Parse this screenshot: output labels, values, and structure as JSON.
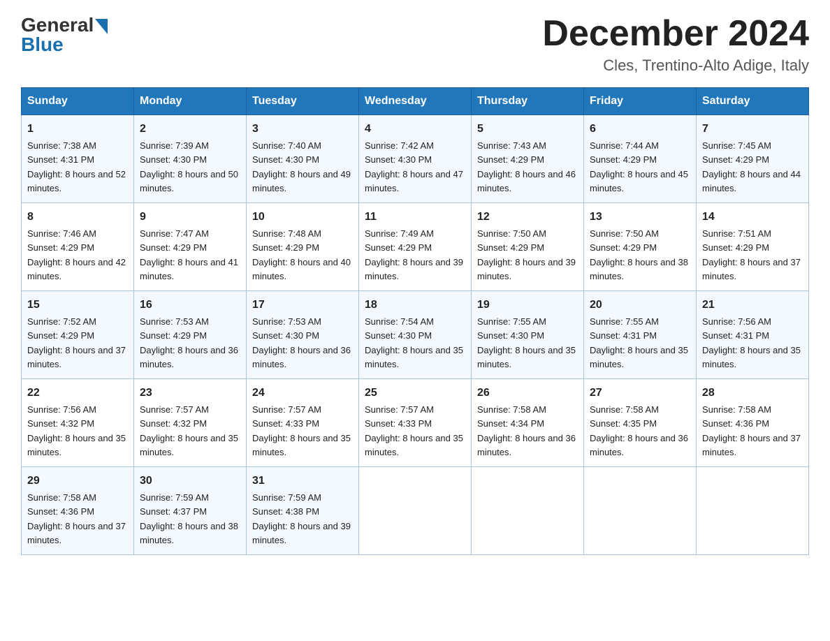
{
  "header": {
    "logo_general": "General",
    "logo_blue": "Blue",
    "month_title": "December 2024",
    "location": "Cles, Trentino-Alto Adige, Italy"
  },
  "days_of_week": [
    "Sunday",
    "Monday",
    "Tuesday",
    "Wednesday",
    "Thursday",
    "Friday",
    "Saturday"
  ],
  "weeks": [
    [
      {
        "day": "1",
        "sunrise": "7:38 AM",
        "sunset": "4:31 PM",
        "daylight": "8 hours and 52 minutes."
      },
      {
        "day": "2",
        "sunrise": "7:39 AM",
        "sunset": "4:30 PM",
        "daylight": "8 hours and 50 minutes."
      },
      {
        "day": "3",
        "sunrise": "7:40 AM",
        "sunset": "4:30 PM",
        "daylight": "8 hours and 49 minutes."
      },
      {
        "day": "4",
        "sunrise": "7:42 AM",
        "sunset": "4:30 PM",
        "daylight": "8 hours and 47 minutes."
      },
      {
        "day": "5",
        "sunrise": "7:43 AM",
        "sunset": "4:29 PM",
        "daylight": "8 hours and 46 minutes."
      },
      {
        "day": "6",
        "sunrise": "7:44 AM",
        "sunset": "4:29 PM",
        "daylight": "8 hours and 45 minutes."
      },
      {
        "day": "7",
        "sunrise": "7:45 AM",
        "sunset": "4:29 PM",
        "daylight": "8 hours and 44 minutes."
      }
    ],
    [
      {
        "day": "8",
        "sunrise": "7:46 AM",
        "sunset": "4:29 PM",
        "daylight": "8 hours and 42 minutes."
      },
      {
        "day": "9",
        "sunrise": "7:47 AM",
        "sunset": "4:29 PM",
        "daylight": "8 hours and 41 minutes."
      },
      {
        "day": "10",
        "sunrise": "7:48 AM",
        "sunset": "4:29 PM",
        "daylight": "8 hours and 40 minutes."
      },
      {
        "day": "11",
        "sunrise": "7:49 AM",
        "sunset": "4:29 PM",
        "daylight": "8 hours and 39 minutes."
      },
      {
        "day": "12",
        "sunrise": "7:50 AM",
        "sunset": "4:29 PM",
        "daylight": "8 hours and 39 minutes."
      },
      {
        "day": "13",
        "sunrise": "7:50 AM",
        "sunset": "4:29 PM",
        "daylight": "8 hours and 38 minutes."
      },
      {
        "day": "14",
        "sunrise": "7:51 AM",
        "sunset": "4:29 PM",
        "daylight": "8 hours and 37 minutes."
      }
    ],
    [
      {
        "day": "15",
        "sunrise": "7:52 AM",
        "sunset": "4:29 PM",
        "daylight": "8 hours and 37 minutes."
      },
      {
        "day": "16",
        "sunrise": "7:53 AM",
        "sunset": "4:29 PM",
        "daylight": "8 hours and 36 minutes."
      },
      {
        "day": "17",
        "sunrise": "7:53 AM",
        "sunset": "4:30 PM",
        "daylight": "8 hours and 36 minutes."
      },
      {
        "day": "18",
        "sunrise": "7:54 AM",
        "sunset": "4:30 PM",
        "daylight": "8 hours and 35 minutes."
      },
      {
        "day": "19",
        "sunrise": "7:55 AM",
        "sunset": "4:30 PM",
        "daylight": "8 hours and 35 minutes."
      },
      {
        "day": "20",
        "sunrise": "7:55 AM",
        "sunset": "4:31 PM",
        "daylight": "8 hours and 35 minutes."
      },
      {
        "day": "21",
        "sunrise": "7:56 AM",
        "sunset": "4:31 PM",
        "daylight": "8 hours and 35 minutes."
      }
    ],
    [
      {
        "day": "22",
        "sunrise": "7:56 AM",
        "sunset": "4:32 PM",
        "daylight": "8 hours and 35 minutes."
      },
      {
        "day": "23",
        "sunrise": "7:57 AM",
        "sunset": "4:32 PM",
        "daylight": "8 hours and 35 minutes."
      },
      {
        "day": "24",
        "sunrise": "7:57 AM",
        "sunset": "4:33 PM",
        "daylight": "8 hours and 35 minutes."
      },
      {
        "day": "25",
        "sunrise": "7:57 AM",
        "sunset": "4:33 PM",
        "daylight": "8 hours and 35 minutes."
      },
      {
        "day": "26",
        "sunrise": "7:58 AM",
        "sunset": "4:34 PM",
        "daylight": "8 hours and 36 minutes."
      },
      {
        "day": "27",
        "sunrise": "7:58 AM",
        "sunset": "4:35 PM",
        "daylight": "8 hours and 36 minutes."
      },
      {
        "day": "28",
        "sunrise": "7:58 AM",
        "sunset": "4:36 PM",
        "daylight": "8 hours and 37 minutes."
      }
    ],
    [
      {
        "day": "29",
        "sunrise": "7:58 AM",
        "sunset": "4:36 PM",
        "daylight": "8 hours and 37 minutes."
      },
      {
        "day": "30",
        "sunrise": "7:59 AM",
        "sunset": "4:37 PM",
        "daylight": "8 hours and 38 minutes."
      },
      {
        "day": "31",
        "sunrise": "7:59 AM",
        "sunset": "4:38 PM",
        "daylight": "8 hours and 39 minutes."
      },
      null,
      null,
      null,
      null
    ]
  ]
}
